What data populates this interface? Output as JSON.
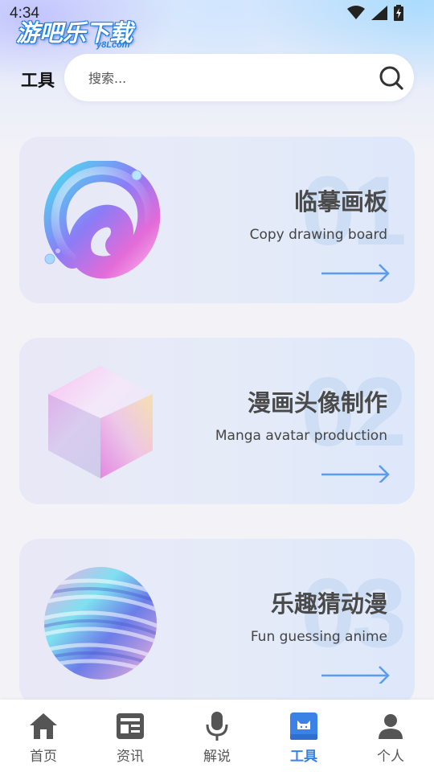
{
  "status_bar": {
    "time": "4:34"
  },
  "logo": {
    "text": "游吧乐下载",
    "sub": "y8Lcom"
  },
  "header": {
    "page_title": "工具"
  },
  "search": {
    "placeholder": "搜索..."
  },
  "cards": [
    {
      "number": "01",
      "title": "临摹画板",
      "subtitle": "Copy drawing board"
    },
    {
      "number": "02",
      "title": "漫画头像制作",
      "subtitle": "Manga avatar production"
    },
    {
      "number": "03",
      "title": "乐趣猜动漫",
      "subtitle": "Fun guessing anime"
    }
  ],
  "tabs": [
    {
      "label": "首页",
      "icon": "home-icon"
    },
    {
      "label": "资讯",
      "icon": "news-icon"
    },
    {
      "label": "解说",
      "icon": "microphone-icon"
    },
    {
      "label": "工具",
      "icon": "toolbox-icon",
      "active": true
    },
    {
      "label": "个人",
      "icon": "user-icon"
    }
  ],
  "colors": {
    "accent": "#3b82e6",
    "arrow": "#5b9bf0",
    "tab_inactive": "#555555"
  }
}
